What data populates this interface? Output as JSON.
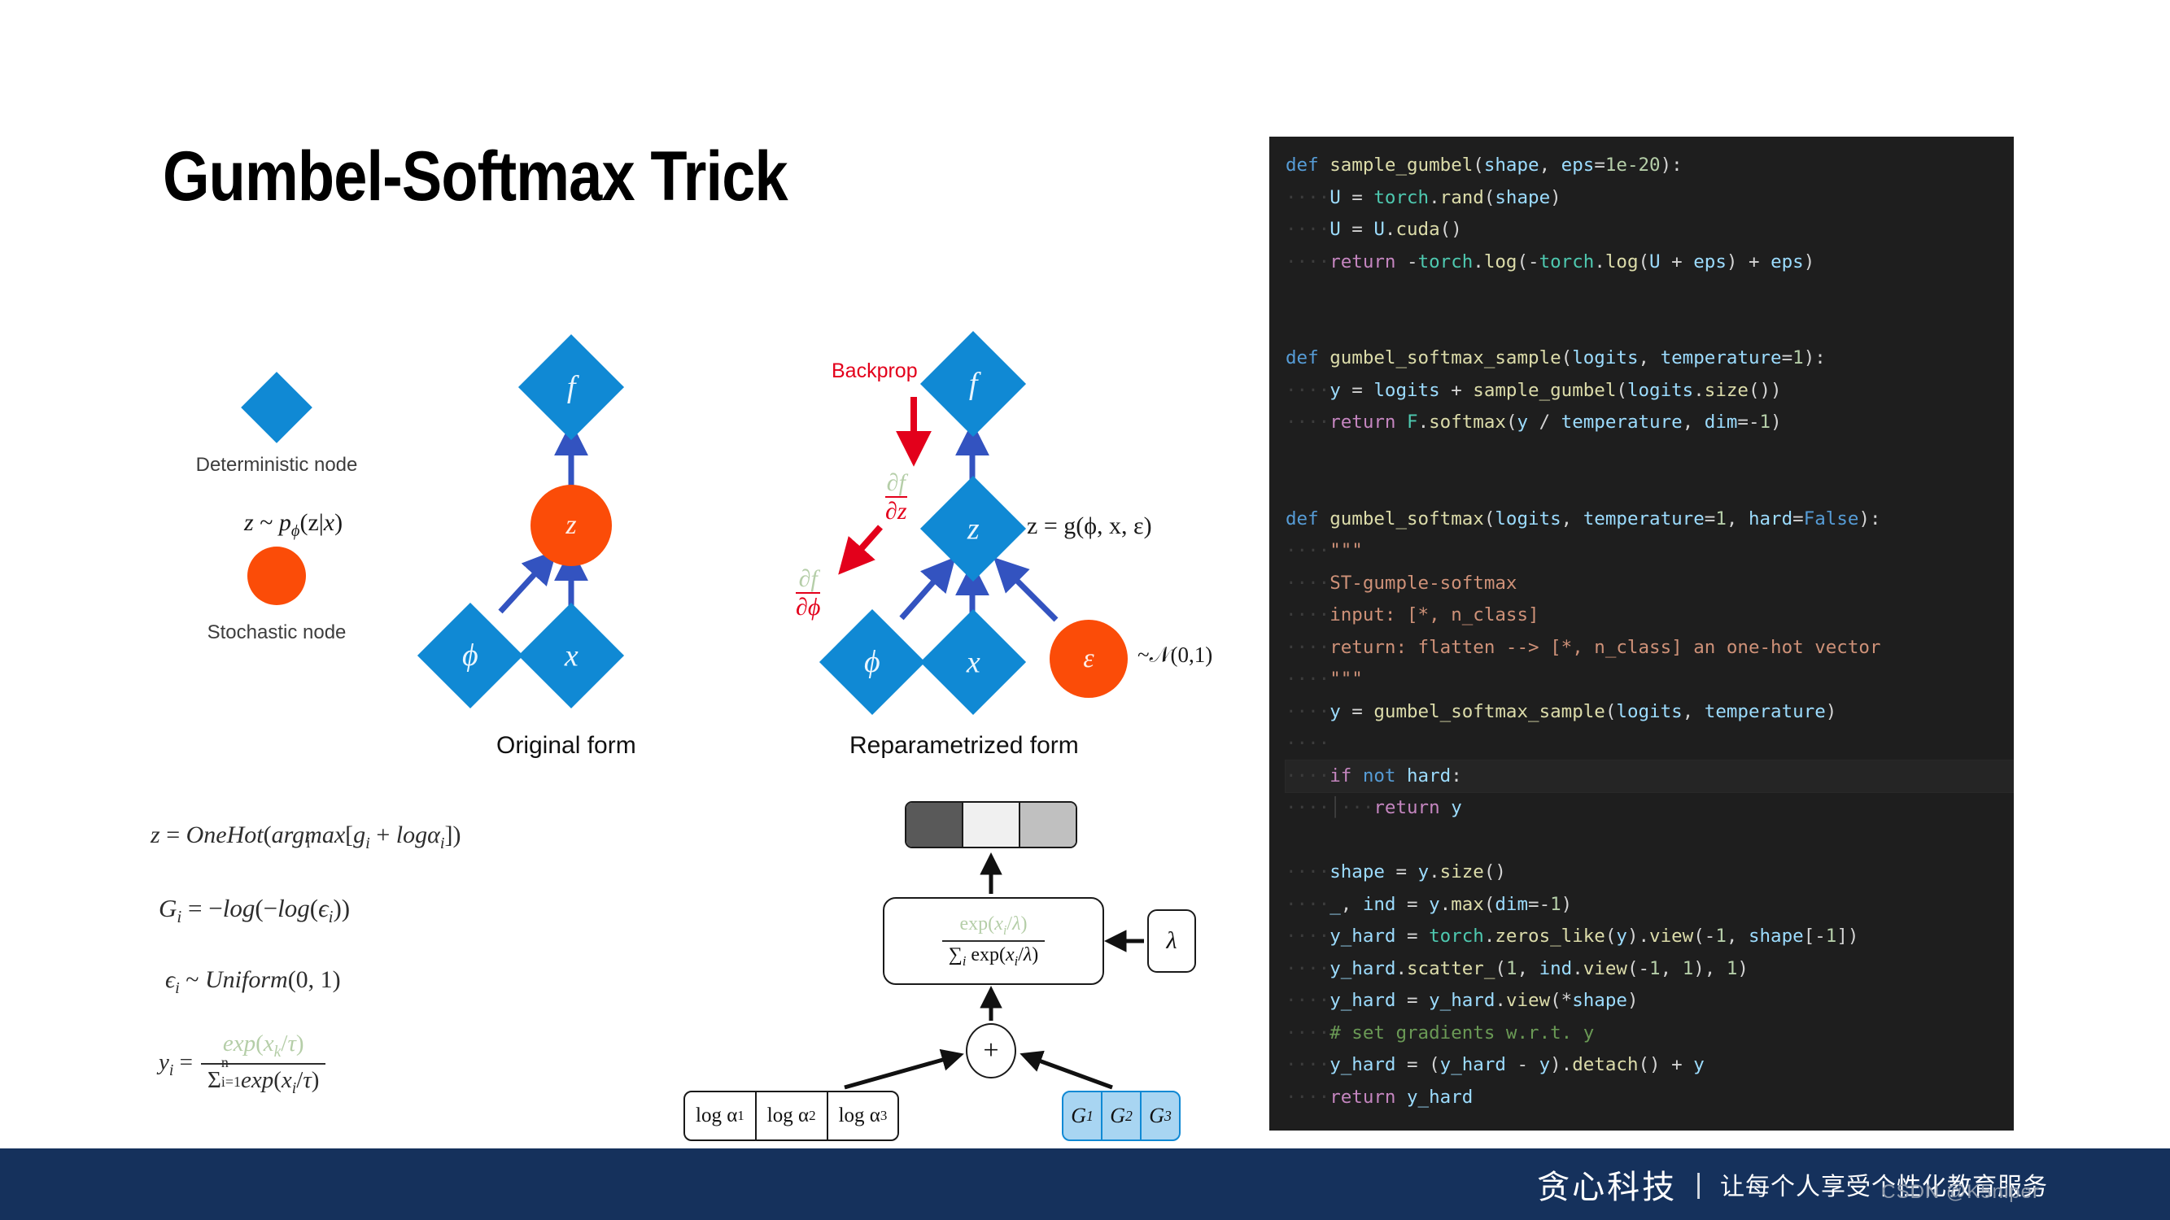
{
  "slide": {
    "title": "Gumbel-Softmax Trick"
  },
  "legend": {
    "deterministic_label": "Deterministic node",
    "stochastic_label": "Stochastic node",
    "deterministic_color": "#1089d4",
    "stochastic_color": "#fb4c08"
  },
  "original_graph": {
    "caption": "Original form",
    "nodes": {
      "f": "f",
      "z": "z",
      "phi": "ϕ",
      "x": "x"
    },
    "annotation": "z ~ pϕ(z|x)"
  },
  "reparam_graph": {
    "caption": "Reparametrized form",
    "nodes": {
      "f": "f",
      "z": "z",
      "phi": "ϕ",
      "x": "x",
      "epsilon": "ε"
    },
    "backprop_label": "Backprop",
    "grad_z_num": "∂f",
    "grad_z_den": "∂z",
    "grad_phi_num": "∂f",
    "grad_phi_den": "∂ϕ",
    "z_equation": "z = g(ϕ, x, ε)",
    "epsilon_dist": "~𝒩(0,1)"
  },
  "equations": {
    "eq1": "z = OneHot(argmax_i [g_i + logα_i])",
    "eq2": "G_i = −log(−log(ϵ_i))",
    "eq3": "ϵ_i ~ Uniform(0, 1)",
    "eq4": "y_i = exp(x_k/τ) / Σ_{i=1}^{n} exp(x_i/τ)",
    "eq1_parts": {
      "lhs": "z = OneHot(",
      "argmax": "argmax",
      "argmax_sub": "i",
      "rhs": "[g",
      "rhs_sub": "i",
      "rhs2": " + logα",
      "rhs2_sub": "i",
      "rhs3": "])"
    },
    "eq2_parts": {
      "lhs": "G",
      "lhs_sub": "i",
      "mid": " = −log(−log(ϵ",
      "sub2": "i",
      "end": "))"
    },
    "eq3_parts": {
      "lhs": "ϵ",
      "lhs_sub": "i",
      "mid": " ~ Uniform(0, 1)"
    },
    "eq4_parts": {
      "lhs": "y",
      "lhs_sub": "i",
      "eq": " =",
      "num": "exp(x",
      "num_sub": "k",
      "num_end": "/τ)",
      "den_sigma": "Σ",
      "den_sub": "i=1",
      "den_sup": "n",
      "den_end": "exp(x",
      "den_end_sub": "i",
      "den_end2": "/τ)"
    }
  },
  "flow_diagram": {
    "output_cells": [
      {
        "shade": "#595959"
      },
      {
        "shade": "#f0f0f0"
      },
      {
        "shade": "#c0c0c0"
      }
    ],
    "softmax_num": "exp(xᵢ/λ)",
    "softmax_den": "∑ᵢ exp(xᵢ/λ)",
    "softmax_num_parts": {
      "a": "exp(x",
      "sub": "i",
      "b": "/λ)"
    },
    "softmax_den_parts": {
      "sigma": "∑",
      "sub": "i",
      "a": " exp(x",
      "sub2": "i",
      "b": "/λ)"
    },
    "lambda_label": "λ",
    "plus_label": "+",
    "log_alpha_cells": [
      {
        "base": "log α",
        "sub": "1"
      },
      {
        "base": "log α",
        "sub": "2"
      },
      {
        "base": "log α",
        "sub": "3"
      }
    ],
    "gumbel_cells": [
      {
        "base": "G",
        "sub": "1"
      },
      {
        "base": "G",
        "sub": "2"
      },
      {
        "base": "G",
        "sub": "3"
      }
    ],
    "gumbel_fill": "#a8d5f2",
    "gumbel_border": "#1089d4"
  },
  "code": {
    "background": "#1e1e1e",
    "lines": [
      [
        {
          "t": "def",
          "c": "kw"
        },
        {
          "t": " ",
          "c": "op"
        },
        {
          "t": "sample_gumbel",
          "c": "fn"
        },
        {
          "t": "(",
          "c": "op"
        },
        {
          "t": "shape",
          "c": "var"
        },
        {
          "t": ", ",
          "c": "op"
        },
        {
          "t": "eps",
          "c": "var"
        },
        {
          "t": "=",
          "c": "op"
        },
        {
          "t": "1e-20",
          "c": "num"
        },
        {
          "t": "):",
          "c": "op"
        }
      ],
      [
        {
          "t": "····",
          "c": "ind"
        },
        {
          "t": "U",
          "c": "var"
        },
        {
          "t": " = ",
          "c": "op"
        },
        {
          "t": "torch",
          "c": "cls"
        },
        {
          "t": ".",
          "c": "op"
        },
        {
          "t": "rand",
          "c": "fn"
        },
        {
          "t": "(",
          "c": "op"
        },
        {
          "t": "shape",
          "c": "var"
        },
        {
          "t": ")",
          "c": "op"
        }
      ],
      [
        {
          "t": "····",
          "c": "ind"
        },
        {
          "t": "U",
          "c": "var"
        },
        {
          "t": " = ",
          "c": "op"
        },
        {
          "t": "U",
          "c": "var"
        },
        {
          "t": ".",
          "c": "op"
        },
        {
          "t": "cuda",
          "c": "fn"
        },
        {
          "t": "()",
          "c": "op"
        }
      ],
      [
        {
          "t": "····",
          "c": "ind"
        },
        {
          "t": "return",
          "c": "kw2"
        },
        {
          "t": " -",
          "c": "op"
        },
        {
          "t": "torch",
          "c": "cls"
        },
        {
          "t": ".",
          "c": "op"
        },
        {
          "t": "log",
          "c": "fn"
        },
        {
          "t": "(-",
          "c": "op"
        },
        {
          "t": "torch",
          "c": "cls"
        },
        {
          "t": ".",
          "c": "op"
        },
        {
          "t": "log",
          "c": "fn"
        },
        {
          "t": "(",
          "c": "op"
        },
        {
          "t": "U",
          "c": "var"
        },
        {
          "t": " + ",
          "c": "op"
        },
        {
          "t": "eps",
          "c": "var"
        },
        {
          "t": ") + ",
          "c": "op"
        },
        {
          "t": "eps",
          "c": "var"
        },
        {
          "t": ")",
          "c": "op"
        }
      ],
      [],
      [],
      [
        {
          "t": "def",
          "c": "kw"
        },
        {
          "t": " ",
          "c": "op"
        },
        {
          "t": "gumbel_softmax_sample",
          "c": "fn"
        },
        {
          "t": "(",
          "c": "op"
        },
        {
          "t": "logits",
          "c": "var"
        },
        {
          "t": ", ",
          "c": "op"
        },
        {
          "t": "temperature",
          "c": "var"
        },
        {
          "t": "=",
          "c": "op"
        },
        {
          "t": "1",
          "c": "num"
        },
        {
          "t": "):",
          "c": "op"
        }
      ],
      [
        {
          "t": "····",
          "c": "ind"
        },
        {
          "t": "y",
          "c": "var"
        },
        {
          "t": " = ",
          "c": "op"
        },
        {
          "t": "logits",
          "c": "var"
        },
        {
          "t": " + ",
          "c": "op"
        },
        {
          "t": "sample_gumbel",
          "c": "fn"
        },
        {
          "t": "(",
          "c": "op"
        },
        {
          "t": "logits",
          "c": "var"
        },
        {
          "t": ".",
          "c": "op"
        },
        {
          "t": "size",
          "c": "fn"
        },
        {
          "t": "())",
          "c": "op"
        }
      ],
      [
        {
          "t": "····",
          "c": "ind"
        },
        {
          "t": "return",
          "c": "kw2"
        },
        {
          "t": " ",
          "c": "op"
        },
        {
          "t": "F",
          "c": "cls"
        },
        {
          "t": ".",
          "c": "op"
        },
        {
          "t": "softmax",
          "c": "fn"
        },
        {
          "t": "(",
          "c": "op"
        },
        {
          "t": "y",
          "c": "var"
        },
        {
          "t": " / ",
          "c": "op"
        },
        {
          "t": "temperature",
          "c": "var"
        },
        {
          "t": ", ",
          "c": "op"
        },
        {
          "t": "dim",
          "c": "var"
        },
        {
          "t": "=-",
          "c": "op"
        },
        {
          "t": "1",
          "c": "num"
        },
        {
          "t": ")",
          "c": "op"
        }
      ],
      [],
      [],
      [
        {
          "t": "def",
          "c": "kw"
        },
        {
          "t": " ",
          "c": "op"
        },
        {
          "t": "gumbel_softmax",
          "c": "fn"
        },
        {
          "t": "(",
          "c": "op"
        },
        {
          "t": "logits",
          "c": "var"
        },
        {
          "t": ", ",
          "c": "op"
        },
        {
          "t": "temperature",
          "c": "var"
        },
        {
          "t": "=",
          "c": "op"
        },
        {
          "t": "1",
          "c": "num"
        },
        {
          "t": ", ",
          "c": "op"
        },
        {
          "t": "hard",
          "c": "var"
        },
        {
          "t": "=",
          "c": "op"
        },
        {
          "t": "False",
          "c": "kw"
        },
        {
          "t": "):",
          "c": "op"
        }
      ],
      [
        {
          "t": "····",
          "c": "ind"
        },
        {
          "t": "\"\"\"",
          "c": "str"
        }
      ],
      [
        {
          "t": "····",
          "c": "ind"
        },
        {
          "t": "ST-gumple-softmax",
          "c": "str"
        }
      ],
      [
        {
          "t": "····",
          "c": "ind"
        },
        {
          "t": "input: [*, n_class]",
          "c": "str"
        }
      ],
      [
        {
          "t": "····",
          "c": "ind"
        },
        {
          "t": "return: flatten --> [*, n_class] an one-hot vector",
          "c": "str"
        }
      ],
      [
        {
          "t": "····",
          "c": "ind"
        },
        {
          "t": "\"\"\"",
          "c": "str"
        }
      ],
      [
        {
          "t": "····",
          "c": "ind"
        },
        {
          "t": "y",
          "c": "var"
        },
        {
          "t": " = ",
          "c": "op"
        },
        {
          "t": "gumbel_softmax_sample",
          "c": "fn"
        },
        {
          "t": "(",
          "c": "op"
        },
        {
          "t": "logits",
          "c": "var"
        },
        {
          "t": ", ",
          "c": "op"
        },
        {
          "t": "temperature",
          "c": "var"
        },
        {
          "t": ")",
          "c": "op"
        }
      ],
      [
        {
          "t": "····",
          "c": "ind"
        }
      ],
      [
        {
          "t": "····",
          "c": "ind"
        },
        {
          "t": "if",
          "c": "kw2"
        },
        {
          "t": " ",
          "c": "op"
        },
        {
          "t": "not",
          "c": "kw"
        },
        {
          "t": " ",
          "c": "op"
        },
        {
          "t": "hard",
          "c": "var"
        },
        {
          "t": ":",
          "c": "op"
        }
      ],
      [
        {
          "t": "····",
          "c": "ind"
        },
        {
          "t": "│",
          "c": "gbar"
        },
        {
          "t": "···",
          "c": "ind"
        },
        {
          "t": "return",
          "c": "kw2"
        },
        {
          "t": " ",
          "c": "op"
        },
        {
          "t": "y",
          "c": "var"
        }
      ],
      [],
      [
        {
          "t": "····",
          "c": "ind"
        },
        {
          "t": "shape",
          "c": "var"
        },
        {
          "t": " = ",
          "c": "op"
        },
        {
          "t": "y",
          "c": "var"
        },
        {
          "t": ".",
          "c": "op"
        },
        {
          "t": "size",
          "c": "fn"
        },
        {
          "t": "()",
          "c": "op"
        }
      ],
      [
        {
          "t": "····",
          "c": "ind"
        },
        {
          "t": "_",
          "c": "var"
        },
        {
          "t": ", ",
          "c": "op"
        },
        {
          "t": "ind",
          "c": "var"
        },
        {
          "t": " = ",
          "c": "op"
        },
        {
          "t": "y",
          "c": "var"
        },
        {
          "t": ".",
          "c": "op"
        },
        {
          "t": "max",
          "c": "fn"
        },
        {
          "t": "(",
          "c": "op"
        },
        {
          "t": "dim",
          "c": "var"
        },
        {
          "t": "=-",
          "c": "op"
        },
        {
          "t": "1",
          "c": "num"
        },
        {
          "t": ")",
          "c": "op"
        }
      ],
      [
        {
          "t": "····",
          "c": "ind"
        },
        {
          "t": "y_hard",
          "c": "var"
        },
        {
          "t": " = ",
          "c": "op"
        },
        {
          "t": "torch",
          "c": "cls"
        },
        {
          "t": ".",
          "c": "op"
        },
        {
          "t": "zeros_like",
          "c": "fn"
        },
        {
          "t": "(",
          "c": "op"
        },
        {
          "t": "y",
          "c": "var"
        },
        {
          "t": ").",
          "c": "op"
        },
        {
          "t": "view",
          "c": "fn"
        },
        {
          "t": "(-",
          "c": "op"
        },
        {
          "t": "1",
          "c": "num"
        },
        {
          "t": ", ",
          "c": "op"
        },
        {
          "t": "shape",
          "c": "var"
        },
        {
          "t": "[-",
          "c": "op"
        },
        {
          "t": "1",
          "c": "num"
        },
        {
          "t": "])",
          "c": "op"
        }
      ],
      [
        {
          "t": "····",
          "c": "ind"
        },
        {
          "t": "y_hard",
          "c": "var"
        },
        {
          "t": ".",
          "c": "op"
        },
        {
          "t": "scatter_",
          "c": "fn"
        },
        {
          "t": "(",
          "c": "op"
        },
        {
          "t": "1",
          "c": "num"
        },
        {
          "t": ", ",
          "c": "op"
        },
        {
          "t": "ind",
          "c": "var"
        },
        {
          "t": ".",
          "c": "op"
        },
        {
          "t": "view",
          "c": "fn"
        },
        {
          "t": "(-",
          "c": "op"
        },
        {
          "t": "1",
          "c": "num"
        },
        {
          "t": ", ",
          "c": "op"
        },
        {
          "t": "1",
          "c": "num"
        },
        {
          "t": "), ",
          "c": "op"
        },
        {
          "t": "1",
          "c": "num"
        },
        {
          "t": ")",
          "c": "op"
        }
      ],
      [
        {
          "t": "····",
          "c": "ind"
        },
        {
          "t": "y_hard",
          "c": "var"
        },
        {
          "t": " = ",
          "c": "op"
        },
        {
          "t": "y_hard",
          "c": "var"
        },
        {
          "t": ".",
          "c": "op"
        },
        {
          "t": "view",
          "c": "fn"
        },
        {
          "t": "(*",
          "c": "op"
        },
        {
          "t": "shape",
          "c": "var"
        },
        {
          "t": ")",
          "c": "op"
        }
      ],
      [
        {
          "t": "····",
          "c": "ind"
        },
        {
          "t": "# set gradients w.r.t. y",
          "c": "cmt"
        }
      ],
      [
        {
          "t": "····",
          "c": "ind"
        },
        {
          "t": "y_hard",
          "c": "var"
        },
        {
          "t": " = (",
          "c": "op"
        },
        {
          "t": "y_hard",
          "c": "var"
        },
        {
          "t": " - ",
          "c": "op"
        },
        {
          "t": "y",
          "c": "var"
        },
        {
          "t": ").",
          "c": "op"
        },
        {
          "t": "detach",
          "c": "fn"
        },
        {
          "t": "() + ",
          "c": "op"
        },
        {
          "t": "y",
          "c": "var"
        }
      ],
      [
        {
          "t": "····",
          "c": "ind"
        },
        {
          "t": "return",
          "c": "kw2"
        },
        {
          "t": " ",
          "c": "op"
        },
        {
          "t": "y_hard",
          "c": "var"
        }
      ]
    ],
    "highlighted_line_index": 19
  },
  "footer": {
    "brand": "贪心科技",
    "divider": "|",
    "tagline": "让每个人享受个性化教育服务",
    "background_color": "#15315c"
  },
  "watermark": {
    "text": "CSDN @K5niper"
  }
}
